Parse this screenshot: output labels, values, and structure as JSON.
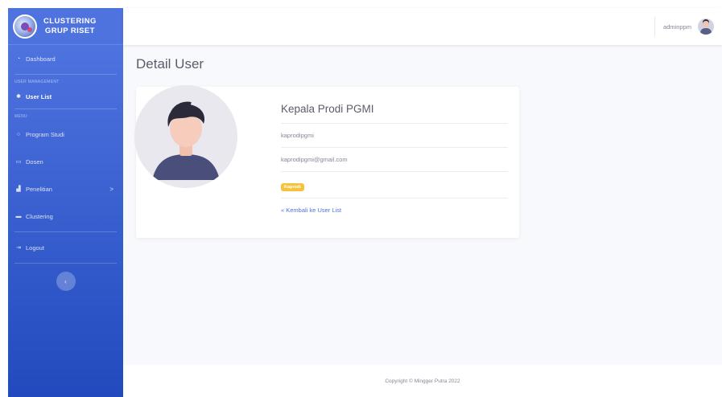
{
  "brand": {
    "line1": "CLUSTERING",
    "line2": "GRUP RISET",
    "logo_icon": "globe-logo-icon"
  },
  "sidebar": {
    "dashboard": {
      "label": "Dashboard",
      "icon": "tachometer-icon"
    },
    "heading_user": "USER MANAGEMENT",
    "user_list": {
      "label": "User List",
      "icon": "user-cog-icon"
    },
    "heading_menu": "MENU",
    "items": [
      {
        "label": "Program Studi",
        "icon": "circle-icon"
      },
      {
        "label": "Dosen",
        "icon": "comment-icon"
      },
      {
        "label": "Penelitian",
        "icon": "chart-icon",
        "chevron": ">"
      },
      {
        "label": "Clustering",
        "icon": "bar-chart-icon"
      }
    ],
    "logout": {
      "label": "Logout",
      "icon": "sign-out-icon"
    },
    "toggle": "‹"
  },
  "topbar": {
    "username": "adminppm"
  },
  "page": {
    "title": "Detail User"
  },
  "user": {
    "name": "Kepala Prodi PGMI",
    "username": "kaprodipgmi",
    "email": "kaprodipgmi@gmail.com",
    "role_badge": "Kaprodi",
    "back_link": "« Kembali ke User List"
  },
  "colors": {
    "sidebar_top": "#4e73df",
    "sidebar_bottom": "#224abe",
    "badge": "#f6c23e",
    "link": "#4e73df"
  },
  "footer": {
    "text": "Copyright © Mingger Putra 2022"
  }
}
